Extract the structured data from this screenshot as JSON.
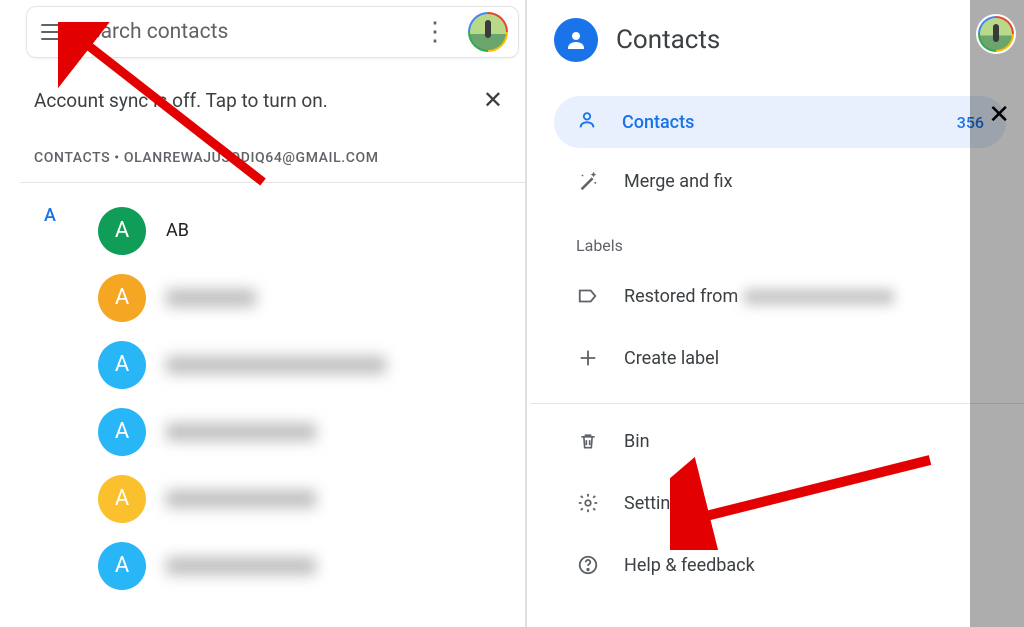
{
  "left": {
    "search_placeholder": "Search contacts",
    "sync_text": "Account sync is off. Tap to turn on.",
    "account_line": "CONTACTS • OLANREWAJUSODIQ64@GMAIL.COM",
    "section_letter": "A",
    "contacts": [
      {
        "initial": "A",
        "color": "c-green",
        "name": "AB",
        "blurred": false
      },
      {
        "initial": "A",
        "color": "c-orange",
        "name": "",
        "blurred": true,
        "blurwidth": "sm"
      },
      {
        "initial": "A",
        "color": "c-blue",
        "name": "",
        "blurred": true,
        "blurwidth": "lg"
      },
      {
        "initial": "A",
        "color": "c-blue",
        "name": "",
        "blurred": true,
        "blurwidth": ""
      },
      {
        "initial": "A",
        "color": "c-yellow",
        "name": "",
        "blurred": true,
        "blurwidth": ""
      },
      {
        "initial": "A",
        "color": "c-blue",
        "name": "",
        "blurred": true,
        "blurwidth": ""
      }
    ]
  },
  "right": {
    "title": "Contacts",
    "active": {
      "label": "Contacts",
      "count": "356"
    },
    "merge_label": "Merge and fix",
    "labels_heading": "Labels",
    "restored_label_prefix": "Restored from",
    "create_label": "Create label",
    "bin_label": "Bin",
    "settings_label": "Settings",
    "help_label": "Help & feedback"
  }
}
